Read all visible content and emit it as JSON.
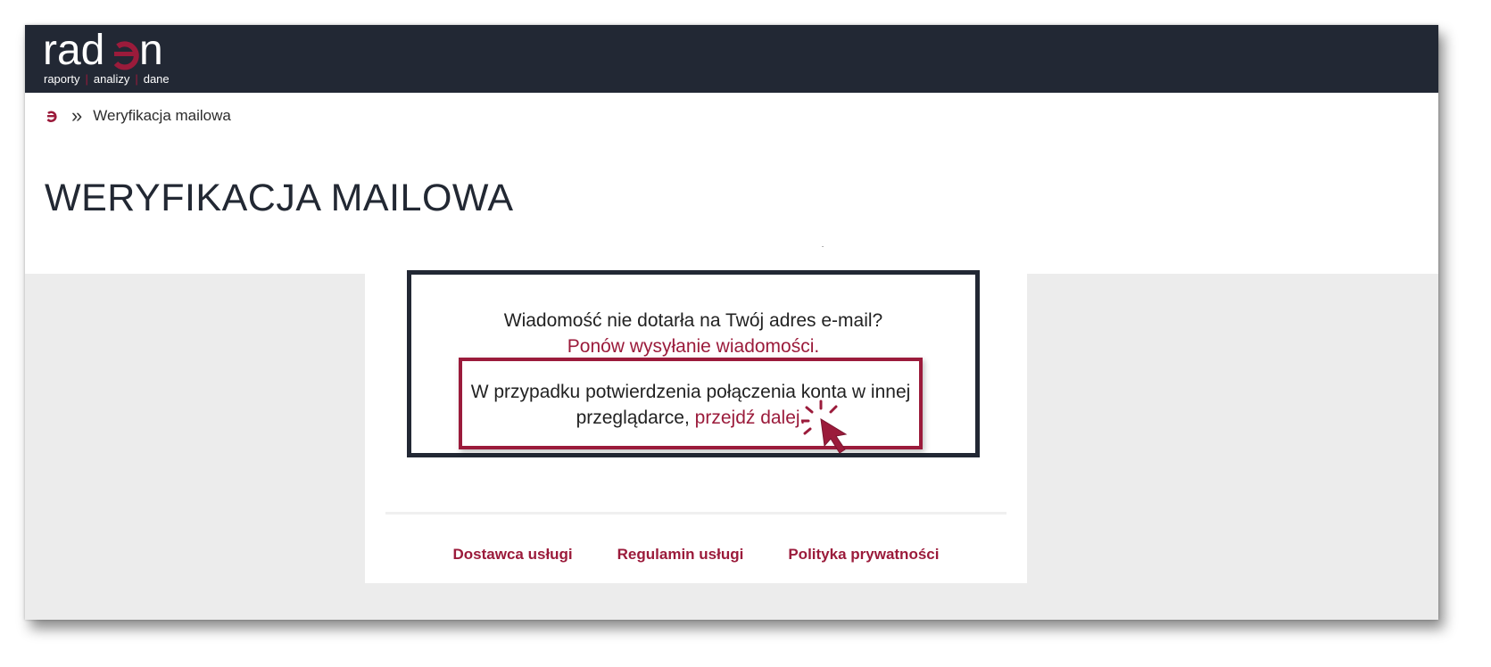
{
  "brand": {
    "logo_text": "radon",
    "tagline": [
      "raporty",
      "analizy",
      "dane"
    ],
    "accent_color": "#9b1b3b",
    "topbar_color": "#222834"
  },
  "breadcrumb": {
    "home_icon": "radon-e-icon",
    "separator": "»",
    "current": "Weryfikacja mailowa"
  },
  "page": {
    "title": "WERYFIKACJA MAILOWA"
  },
  "notice": {
    "question": "Wiadomość nie dotarła na Twój adres e-mail?",
    "resend_link": "Ponów wysyłanie wiadomości",
    "resend_suffix": ".",
    "other_browser_text": "W przypadku potwierdzenia połączenia konta w innej przeglądarce,",
    "proceed_link": "przejdź dalej",
    "proceed_suffix": "."
  },
  "footer": {
    "links": [
      "Dostawca usługi",
      "Regulamin usługi",
      "Polityka prywatności"
    ]
  }
}
